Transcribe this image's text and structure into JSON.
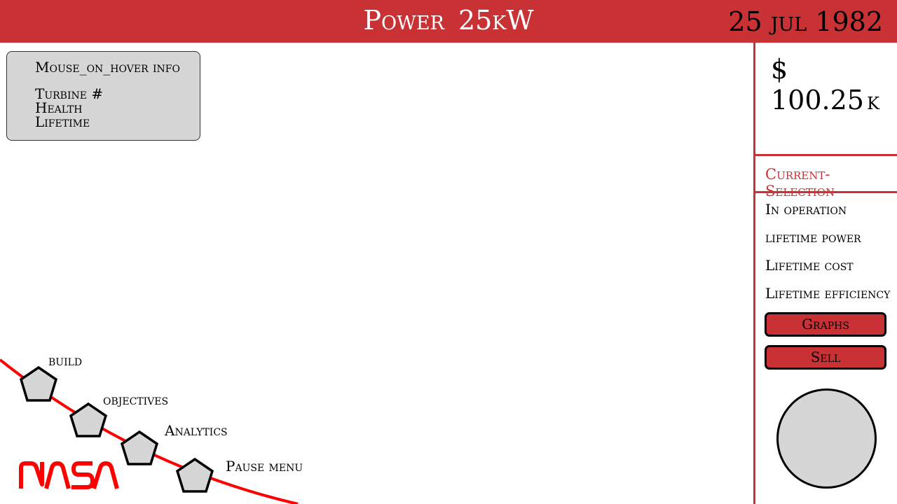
{
  "header": {
    "power_label": "Power",
    "power_value": "25kW",
    "date": "25 jul 1982"
  },
  "hover_info": {
    "title": "Mouse_on_hover info",
    "lines": [
      "Turbine #",
      "Health",
      "Lifetime"
    ]
  },
  "sidebar": {
    "money_value": "$ 100.25",
    "money_unit": "k",
    "current_selection_label": "Current-Selection",
    "stats": [
      "In operation",
      "lifetime power",
      "Lifetime cost",
      "Lifetime efficiency"
    ],
    "graphs_button": "Graphs",
    "sell_button": "Sell"
  },
  "menu": {
    "items": [
      "build",
      "objectives",
      "Analytics",
      "Pause menu"
    ]
  },
  "logo": {
    "text": "NASA"
  },
  "colors": {
    "accent": "#c83234",
    "panel": "#d6d6d6",
    "curve": "#ff0000"
  }
}
